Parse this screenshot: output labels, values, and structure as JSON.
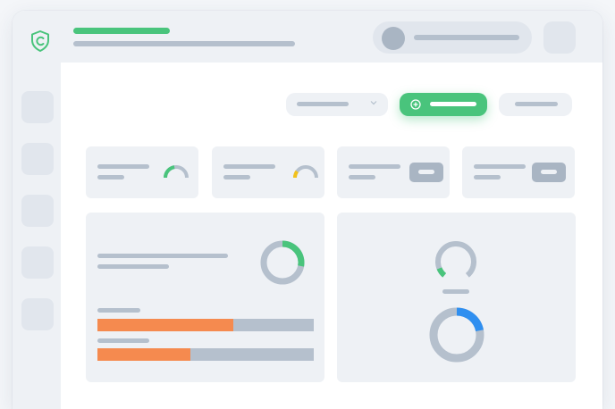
{
  "colors": {
    "accent_green": "#49c47c",
    "accent_orange": "#f58a4f",
    "accent_blue": "#2f8ff0",
    "accent_yellow": "#f2c21b",
    "skeleton_grey": "#b5c0cd",
    "panel_bg": "#eef1f5"
  },
  "icons": {
    "logo": "shield-c-logo-icon",
    "dropdown": "chevron-down-icon",
    "primary_button": "plus-circle-icon",
    "user": "avatar-icon"
  },
  "stat_cards": [
    {
      "indicator": "gauge",
      "gauge_fraction": 0.45,
      "gauge_color": "#49c47c"
    },
    {
      "indicator": "gauge",
      "gauge_fraction": 0.2,
      "gauge_color": "#f2c21b"
    },
    {
      "indicator": "badge"
    },
    {
      "indicator": "badge"
    }
  ],
  "left_panel": {
    "donut_fraction": 0.28,
    "donut_color": "#49c47c",
    "progress_bars": [
      {
        "fraction": 0.63,
        "color": "#f58a4f"
      },
      {
        "fraction": 0.43,
        "color": "#f58a4f"
      }
    ]
  },
  "right_panel": {
    "ring_gap_gauge_fraction": 0.1,
    "ring_gap_gauge_color": "#49c47c",
    "donut_fraction": 0.22,
    "donut_color": "#2f8ff0"
  }
}
